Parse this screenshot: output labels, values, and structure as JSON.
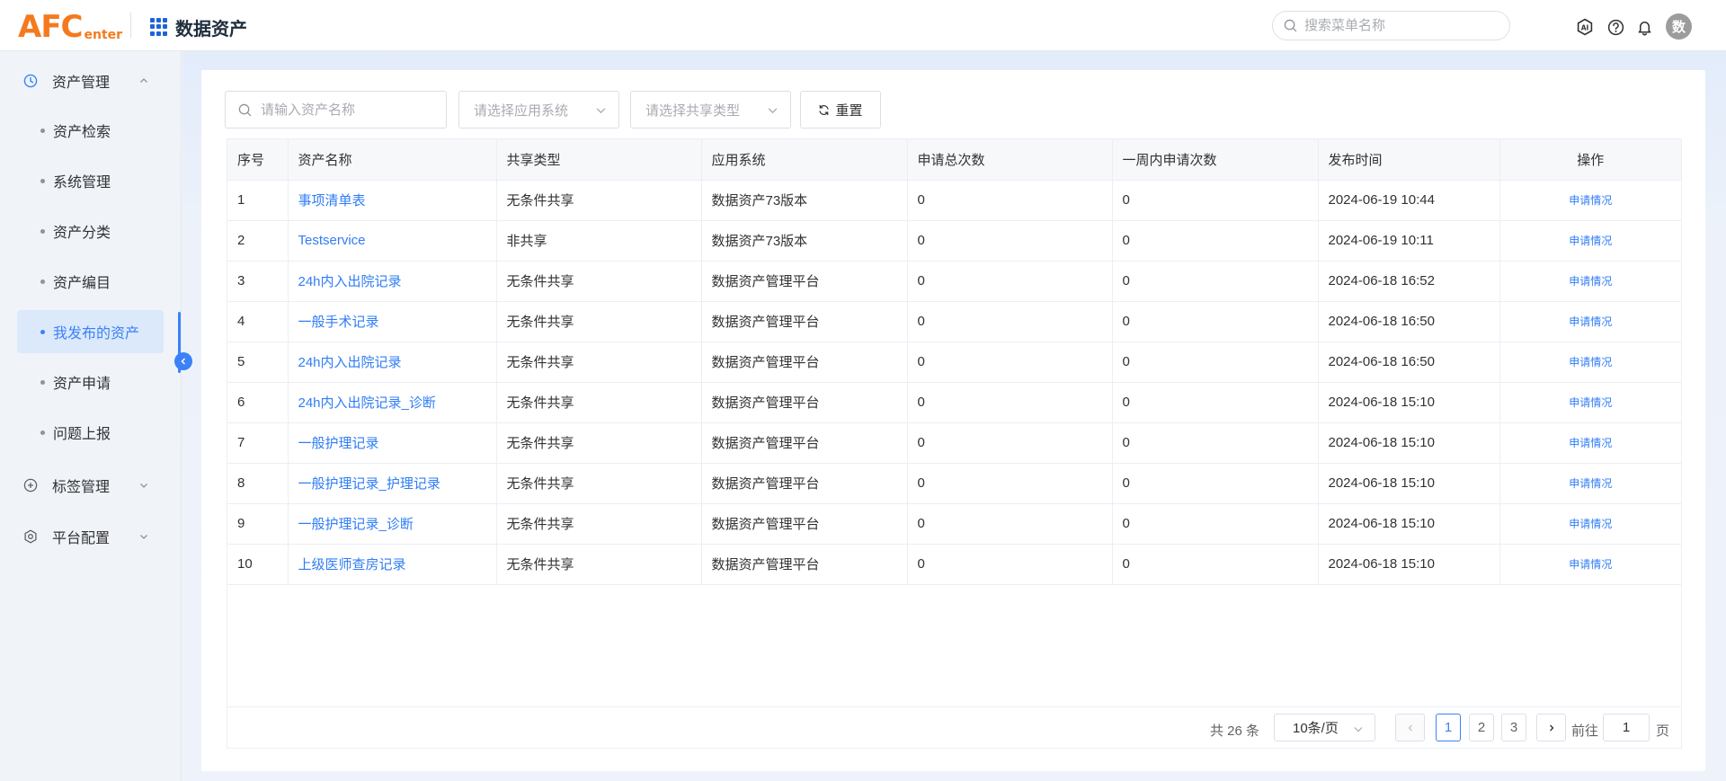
{
  "header": {
    "logo_main": "AFC",
    "logo_sub": "enter",
    "app_title": "数据资产",
    "search_placeholder": "搜索菜单名称",
    "avatar_text": "数"
  },
  "sidebar": {
    "groups": [
      {
        "label": "资产管理",
        "icon": "clock-icon",
        "expanded": true
      },
      {
        "label": "标签管理",
        "icon": "plus-circle-icon",
        "expanded": false
      },
      {
        "label": "平台配置",
        "icon": "settings-icon",
        "expanded": false
      }
    ],
    "items": [
      {
        "label": "资产检索"
      },
      {
        "label": "系统管理"
      },
      {
        "label": "资产分类"
      },
      {
        "label": "资产编目"
      },
      {
        "label": "我发布的资产",
        "active": true
      },
      {
        "label": "资产申请"
      },
      {
        "label": "问题上报"
      }
    ]
  },
  "filters": {
    "name_placeholder": "请输入资产名称",
    "app_system_placeholder": "请选择应用系统",
    "share_type_placeholder": "请选择共享类型",
    "reset_label": "重置"
  },
  "table": {
    "columns": [
      "序号",
      "资产名称",
      "共享类型",
      "应用系统",
      "申请总次数",
      "一周内申请次数",
      "发布时间",
      "操作"
    ],
    "rows": [
      {
        "no": "1",
        "name": "事项清单表",
        "share_type": "无条件共享",
        "app_system": "数据资产73版本",
        "total": "0",
        "week": "0",
        "time": "2024-06-19 10:44",
        "op": "申请情况"
      },
      {
        "no": "2",
        "name": "Testservice",
        "share_type": "非共享",
        "app_system": "数据资产73版本",
        "total": "0",
        "week": "0",
        "time": "2024-06-19 10:11",
        "op": "申请情况"
      },
      {
        "no": "3",
        "name": "24h内入出院记录",
        "share_type": "无条件共享",
        "app_system": "数据资产管理平台",
        "total": "0",
        "week": "0",
        "time": "2024-06-18 16:52",
        "op": "申请情况"
      },
      {
        "no": "4",
        "name": "一般手术记录",
        "share_type": "无条件共享",
        "app_system": "数据资产管理平台",
        "total": "0",
        "week": "0",
        "time": "2024-06-18 16:50",
        "op": "申请情况"
      },
      {
        "no": "5",
        "name": "24h内入出院记录",
        "share_type": "无条件共享",
        "app_system": "数据资产管理平台",
        "total": "0",
        "week": "0",
        "time": "2024-06-18 16:50",
        "op": "申请情况"
      },
      {
        "no": "6",
        "name": "24h内入出院记录_诊断",
        "share_type": "无条件共享",
        "app_system": "数据资产管理平台",
        "total": "0",
        "week": "0",
        "time": "2024-06-18 15:10",
        "op": "申请情况"
      },
      {
        "no": "7",
        "name": "一般护理记录",
        "share_type": "无条件共享",
        "app_system": "数据资产管理平台",
        "total": "0",
        "week": "0",
        "time": "2024-06-18 15:10",
        "op": "申请情况"
      },
      {
        "no": "8",
        "name": "一般护理记录_护理记录",
        "share_type": "无条件共享",
        "app_system": "数据资产管理平台",
        "total": "0",
        "week": "0",
        "time": "2024-06-18 15:10",
        "op": "申请情况"
      },
      {
        "no": "9",
        "name": "一般护理记录_诊断",
        "share_type": "无条件共享",
        "app_system": "数据资产管理平台",
        "total": "0",
        "week": "0",
        "time": "2024-06-18 15:10",
        "op": "申请情况"
      },
      {
        "no": "10",
        "name": "上级医师查房记录",
        "share_type": "无条件共享",
        "app_system": "数据资产管理平台",
        "total": "0",
        "week": "0",
        "time": "2024-06-18 15:10",
        "op": "申请情况"
      }
    ]
  },
  "pagination": {
    "total_text": "共 26 条",
    "page_size": "10条/页",
    "pages": [
      "1",
      "2",
      "3"
    ],
    "current_page": "1",
    "goto_prefix": "前往",
    "goto_value": "1",
    "goto_suffix": "页"
  },
  "colors": {
    "accent": "#3b82f6",
    "logo": "#f47a1f",
    "link": "#2f7df6"
  }
}
